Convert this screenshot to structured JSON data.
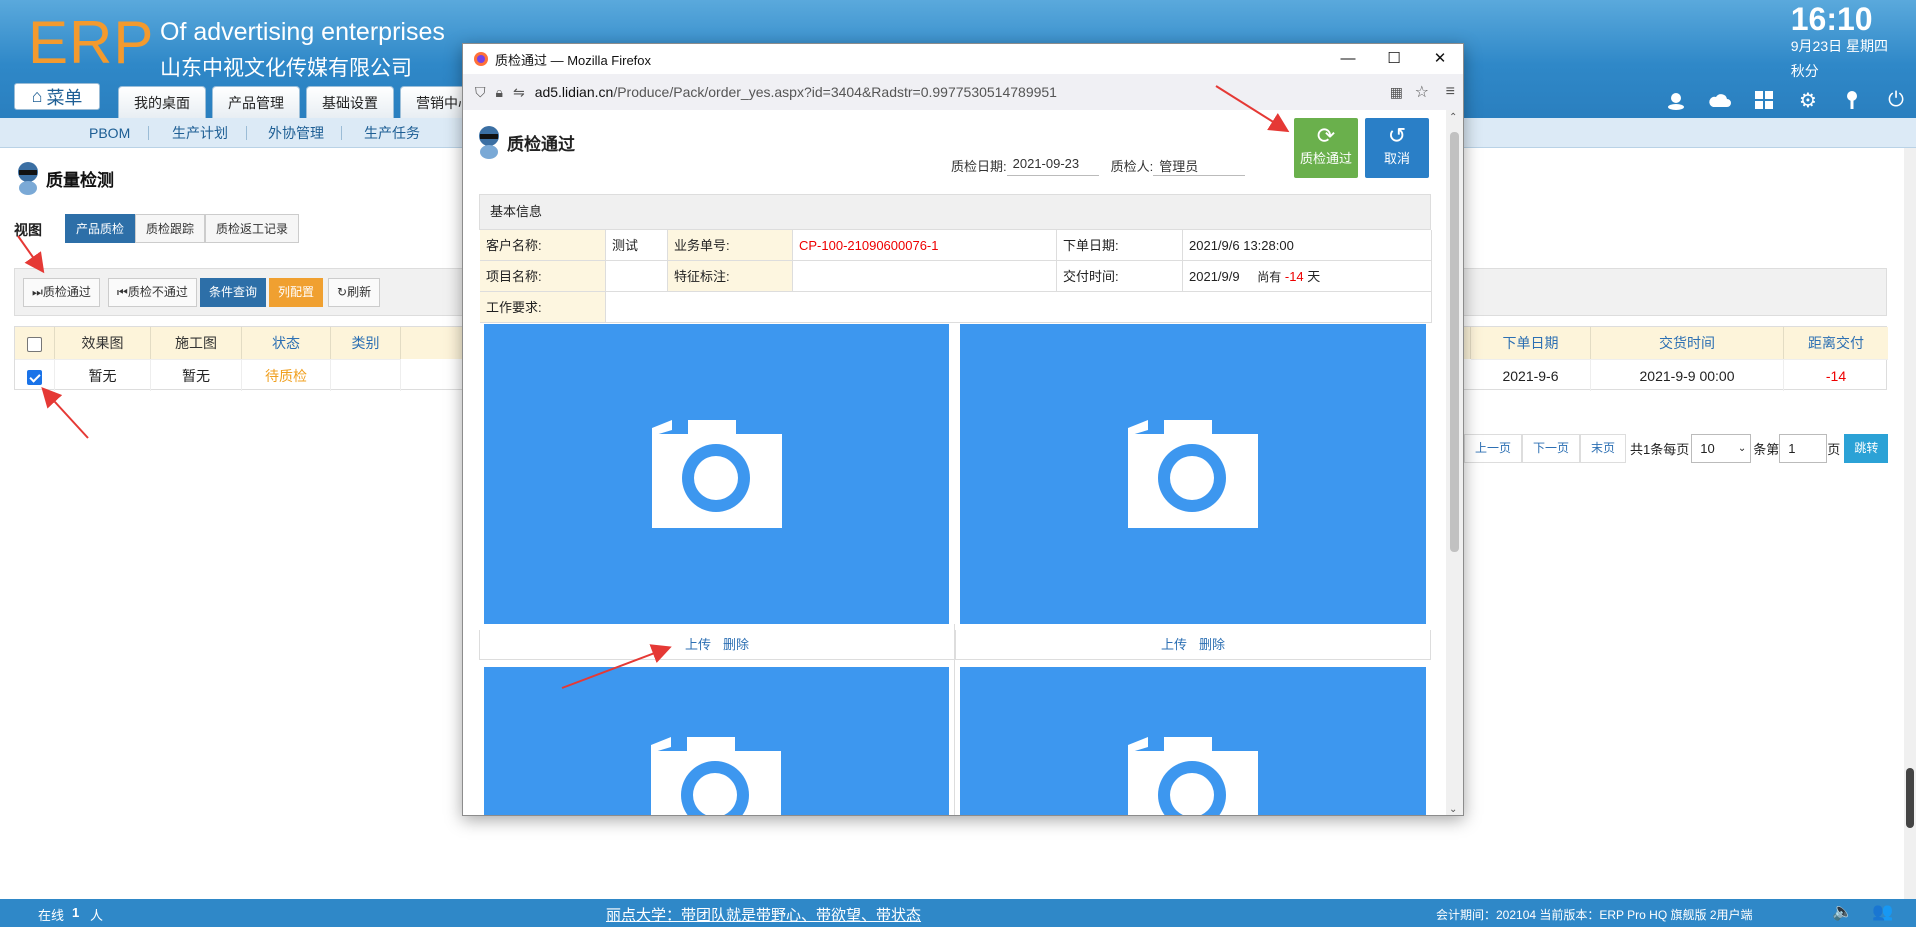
{
  "header": {
    "logo": "ERP",
    "brand_line1": "Of advertising enterprises",
    "brand_line2": "山东中视文化传媒有限公司",
    "time": "16:10",
    "date": "9月23日 星期四",
    "season": "秋分",
    "menu_label": "菜单",
    "tabs": [
      "我的桌面",
      "产品管理",
      "基础设置",
      "营销中心"
    ],
    "icons": [
      "user-icon",
      "cloud-icon",
      "apps-icon",
      "gear-icon",
      "key-icon",
      "power-icon"
    ]
  },
  "subnav": [
    "PBOM",
    "生产计划",
    "外协管理",
    "生产任务"
  ],
  "page": {
    "title": "质量检测",
    "view_label": "视图",
    "view_tabs": [
      "产品质检",
      "质检跟踪",
      "质检返工记录"
    ],
    "toolbar": {
      "pass": "质检通过",
      "fail": "质检不通过",
      "query": "条件查询",
      "columns": "列配置",
      "refresh": "刷新"
    },
    "table": {
      "headers_left": [
        "效果图",
        "施工图",
        "状态",
        "类别"
      ],
      "headers_right": [
        "下单日期",
        "交货时间",
        "距离交付"
      ],
      "row": {
        "effect": "暂无",
        "construction": "暂无",
        "status": "待质检",
        "category": "",
        "order_date": "2021-9-6",
        "delivery": "2021-9-9 00:00",
        "remaining": "-14"
      }
    },
    "pager": {
      "prev": "上一页",
      "next": "下一页",
      "last": "末页",
      "summary": "共1条每页",
      "page_size": "10",
      "unit": "条第",
      "page": "1",
      "page_suffix": "页",
      "go": "跳转"
    }
  },
  "footer": {
    "online": "在线",
    "online_count": "1",
    "online_unit": "人",
    "marquee": "丽点大学：带团队就是带野心、带欲望、带状态",
    "version": "会计期间：202104 当前版本：ERP Pro HQ 旗舰版 2用户端"
  },
  "popup": {
    "window_title": "质检通过 — Mozilla Firefox",
    "url_host": "ad5.lidian.cn",
    "url_path": "/Produce/Pack/order_yes.aspx?id=3404&Radstr=0.9977530514789951",
    "title": "质检通过",
    "inspect_date_label": "质检日期:",
    "inspect_date": "2021-09-23",
    "inspector_label": "质检人:",
    "inspector": "管理员",
    "pass_button": "质检通过",
    "cancel_button": "取消",
    "section": "基本信息",
    "customer_label": "客户名称:",
    "customer": "测试",
    "order_no_label": "业务单号:",
    "order_no": "CP-100-21090600076-1",
    "order_date_label": "下单日期:",
    "order_date": "2021/9/6 13:28:00",
    "project_label": "项目名称:",
    "project": "",
    "feature_label": "特征标注:",
    "feature": "",
    "delivery_label": "交付时间:",
    "delivery": "2021/9/9",
    "remain_prefix": "尚有",
    "remain_days": "-14",
    "remain_unit": "天",
    "work_label": "工作要求:",
    "work": "",
    "upload": "上传",
    "delete": "删除"
  },
  "colors": {
    "header_blue": "#2f88c8",
    "accent_orange": "#f39a2e",
    "photo_blue": "#3d97ef",
    "pass_green": "#6ab04c",
    "cancel_blue": "#2a7fc7",
    "status_orange": "#f0a020",
    "red": "#e00000",
    "arrow_red": "#e53935"
  }
}
